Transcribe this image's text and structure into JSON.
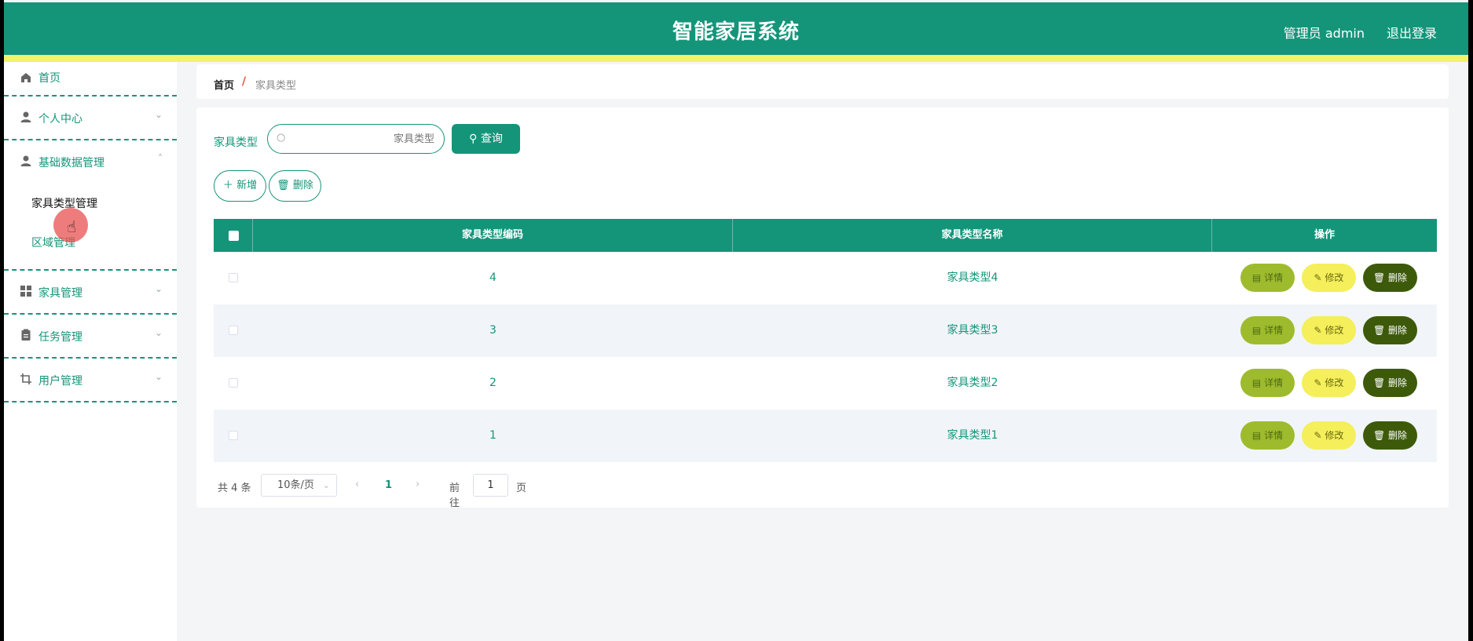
{
  "header": {
    "title": "智能家居系统",
    "user": "管理员 admin",
    "logout": "退出登录"
  },
  "sidebar": {
    "home": "首页",
    "personal": "个人中心",
    "basic": "基础数据管理",
    "sub_type": "家具类型管理",
    "sub_area": "区域管理",
    "furniture": "家具管理",
    "task": "任务管理",
    "user": "用户管理"
  },
  "breadcrumb": {
    "home": "首页",
    "sep": "/",
    "current": "家具类型"
  },
  "search": {
    "label": "家具类型",
    "placeholder": "家具类型",
    "button": "查询"
  },
  "actions": {
    "add": "新增",
    "delete": "删除"
  },
  "table": {
    "columns": [
      "家具类型编码",
      "家具类型名称",
      "操作"
    ],
    "rows": [
      {
        "code": "4",
        "name": "家具类型4"
      },
      {
        "code": "3",
        "name": "家具类型3"
      },
      {
        "code": "2",
        "name": "家具类型2"
      },
      {
        "code": "1",
        "name": "家具类型1"
      }
    ],
    "ops": {
      "detail": "详情",
      "edit": "修改",
      "delete": "删除"
    }
  },
  "pagination": {
    "total": "共 4 条",
    "page_size": "10条/页",
    "current": "1",
    "goto_prefix": "前往",
    "goto_value": "1",
    "goto_suffix": "页"
  },
  "colors": {
    "primary": "#14957a",
    "accent_bar": "#f2f36a",
    "detail_btn": "#9ebb2e",
    "edit_btn": "#f4ef5a",
    "delete_btn": "#3d5a0a"
  }
}
